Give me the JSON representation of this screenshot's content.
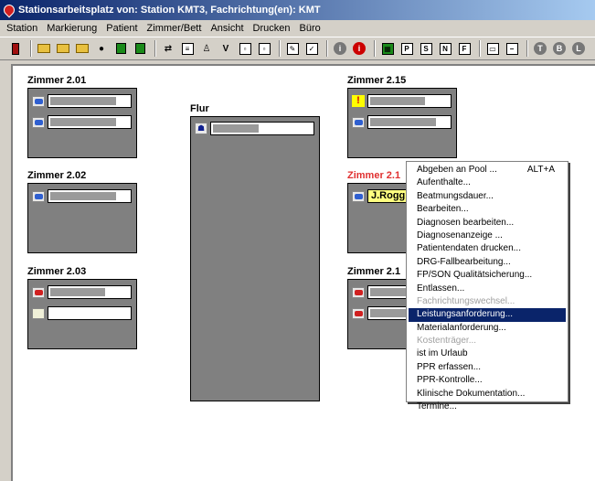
{
  "window": {
    "title": "Stationsarbeitsplatz von: Station KMT3, Fachrichtung(en): KMT"
  },
  "menu": [
    "Station",
    "Markierung",
    "Patient",
    "Zimmer/Bett",
    "Ansicht",
    "Drucken",
    "Büro"
  ],
  "toolbar": {
    "letters": {
      "v": "V",
      "p": "P",
      "s": "S",
      "n": "N",
      "f": "F",
      "t": "T",
      "b": "B",
      "l": "L",
      "i": "i"
    }
  },
  "rooms": {
    "r201": {
      "title": "Zimmer 2.01"
    },
    "r202": {
      "title": "Zimmer 2.02"
    },
    "r203": {
      "title": "Zimmer 2.03"
    },
    "flur": {
      "title": "Flur"
    },
    "r215": {
      "title": "Zimmer 2.15"
    },
    "r216": {
      "title": "Zimmer 2.1",
      "patient": "J.Rogg"
    },
    "r217": {
      "title": "Zimmer 2.1"
    }
  },
  "context_menu": {
    "items": [
      {
        "label": "Abgeben an Pool ...",
        "shortcut": "ALT+A"
      },
      {
        "label": "Aufenthalte...",
        "shortcut": ""
      },
      {
        "label": "Beatmungsdauer...",
        "shortcut": ""
      },
      {
        "label": "Bearbeiten...",
        "shortcut": ""
      },
      {
        "label": "Diagnosen bearbeiten...",
        "shortcut": ""
      },
      {
        "label": "Diagnosenanzeige ...",
        "shortcut": ""
      },
      {
        "label": "Patientendaten drucken...",
        "shortcut": ""
      },
      {
        "label": "DRG-Fallbearbeitung...",
        "shortcut": ""
      },
      {
        "label": "FP/SON Qualitätsicherung...",
        "shortcut": ""
      },
      {
        "label": "Entlassen...",
        "shortcut": ""
      },
      {
        "label": "Fachrichtungswechsel...",
        "shortcut": ""
      },
      {
        "label": "Leistungsanforderung...",
        "shortcut": ""
      },
      {
        "label": "Materialanforderung...",
        "shortcut": ""
      },
      {
        "label": "Kostenträger...",
        "shortcut": ""
      },
      {
        "label": "ist im Urlaub",
        "shortcut": ""
      },
      {
        "label": "PPR erfassen...",
        "shortcut": ""
      },
      {
        "label": "PPR-Kontrolle...",
        "shortcut": ""
      },
      {
        "label": "Klinische Dokumentation...",
        "shortcut": ""
      },
      {
        "label": "Termine...",
        "shortcut": ""
      }
    ],
    "disabled": [
      10,
      13
    ],
    "selected": 11
  }
}
